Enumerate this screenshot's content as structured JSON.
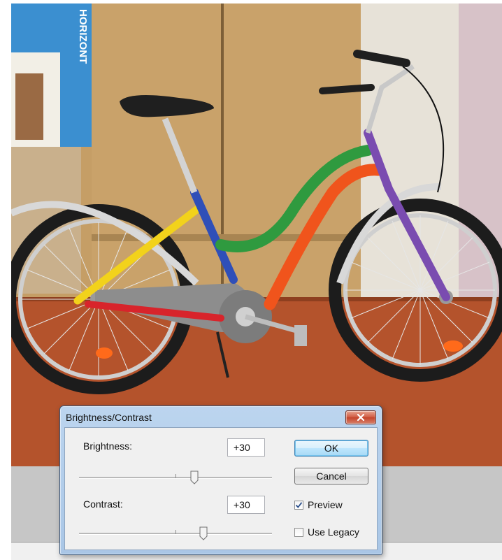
{
  "dialog": {
    "title": "Brightness/Contrast",
    "brightness": {
      "label": "Brightness:",
      "value": "+30",
      "slider_level": 0.6
    },
    "contrast": {
      "label": "Contrast:",
      "value": "+30",
      "slider_level": 0.6
    },
    "ok_label": "OK",
    "cancel_label": "Cancel",
    "preview": {
      "label": "Preview",
      "checked": true
    },
    "use_legacy": {
      "label": "Use Legacy",
      "checked": false
    }
  },
  "photo": {
    "box_text": "HORIZONT",
    "colors": {
      "wall": "#c9a46c",
      "floor": "#b5532b",
      "frame_yellow": "#f2d21b",
      "frame_blue": "#2f4fb8",
      "frame_green": "#2f9a3f",
      "frame_orange": "#f0541c",
      "frame_purple": "#7a4cb0",
      "frame_red": "#d8242b"
    }
  },
  "icons": {
    "close": "close-icon",
    "thumb": "slider-thumb-icon",
    "check": "checkmark-icon"
  }
}
